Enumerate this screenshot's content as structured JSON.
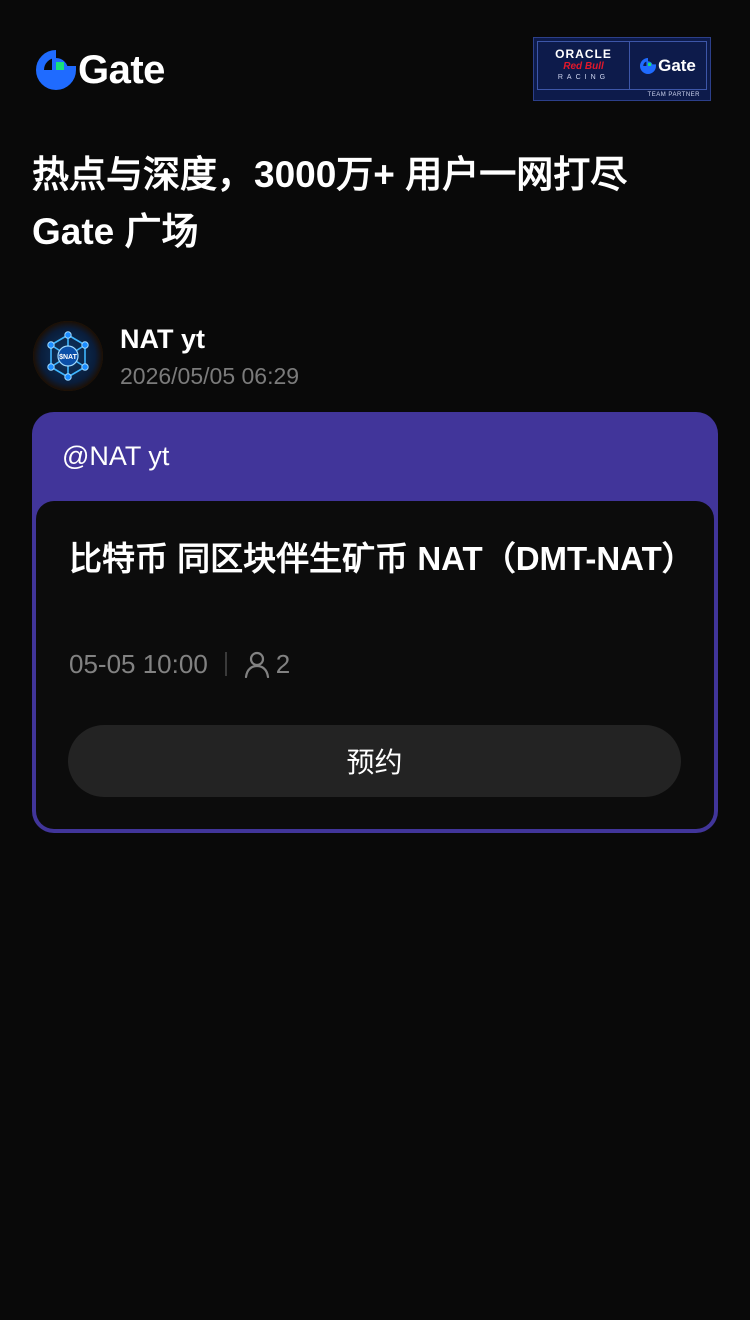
{
  "header": {
    "logo_text": "Gate",
    "partner_badge": {
      "oracle": "ORACLE",
      "redbull": "Red Bull",
      "racing": "RACING",
      "gate": "Gate",
      "team_partner": "TEAM PARTNER"
    }
  },
  "headline": {
    "line1": "热点与深度，3000万+ 用户一网打尽",
    "line2": "Gate 广场"
  },
  "author": {
    "avatar_text": "$NAT",
    "name": "NAT yt",
    "timestamp": "2026/05/05 06:29"
  },
  "card": {
    "mention": "@NAT yt",
    "event_title": "比特币 同区块伴生矿币 NAT（DMT-NAT）",
    "event_time": "05-05 10:00",
    "participants": "2",
    "reserve_label": "预约"
  },
  "colors": {
    "background": "#090909",
    "card_accent": "#41359a",
    "gate_blue": "#1f6bff",
    "gate_green": "#17e07a"
  }
}
